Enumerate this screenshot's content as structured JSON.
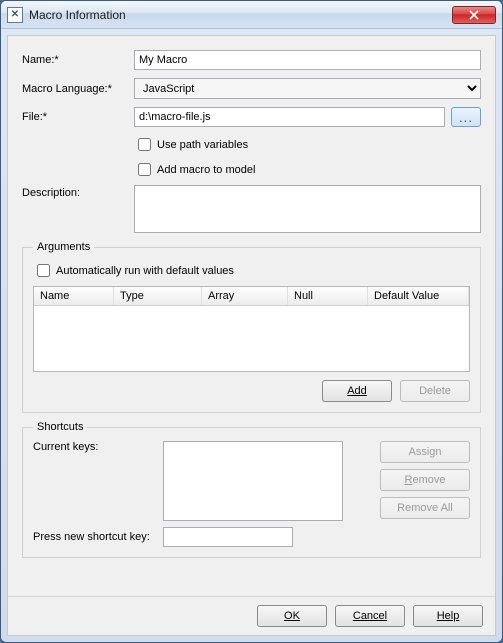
{
  "window": {
    "title": "Macro Information"
  },
  "labels": {
    "name": "Name:*",
    "language": "Macro Language:*",
    "file": "File:*",
    "use_path_vars": "Use path variables",
    "add_to_model": "Add macro to model",
    "description": "Description:",
    "arguments_group": "Arguments",
    "auto_run": "Automatically run with default values",
    "shortcuts_group": "Shortcuts",
    "current_keys": "Current keys:",
    "press_new": "Press new shortcut key:"
  },
  "fields": {
    "name": "My Macro",
    "language_selected": "JavaScript",
    "file": "d:\\macro-file.js",
    "use_path_vars_checked": false,
    "add_to_model_checked": false,
    "description": "",
    "auto_run_checked": false,
    "current_keys": "",
    "press_new": ""
  },
  "table": {
    "columns": [
      "Name",
      "Type",
      "Array",
      "Null",
      "Default Value"
    ]
  },
  "buttons": {
    "browse": "...",
    "add": "Add",
    "delete": "Delete",
    "assign": "Assign",
    "remove": "Remove",
    "remove_all": "Remove All",
    "ok": "OK",
    "cancel": "Cancel",
    "help": "Help"
  }
}
